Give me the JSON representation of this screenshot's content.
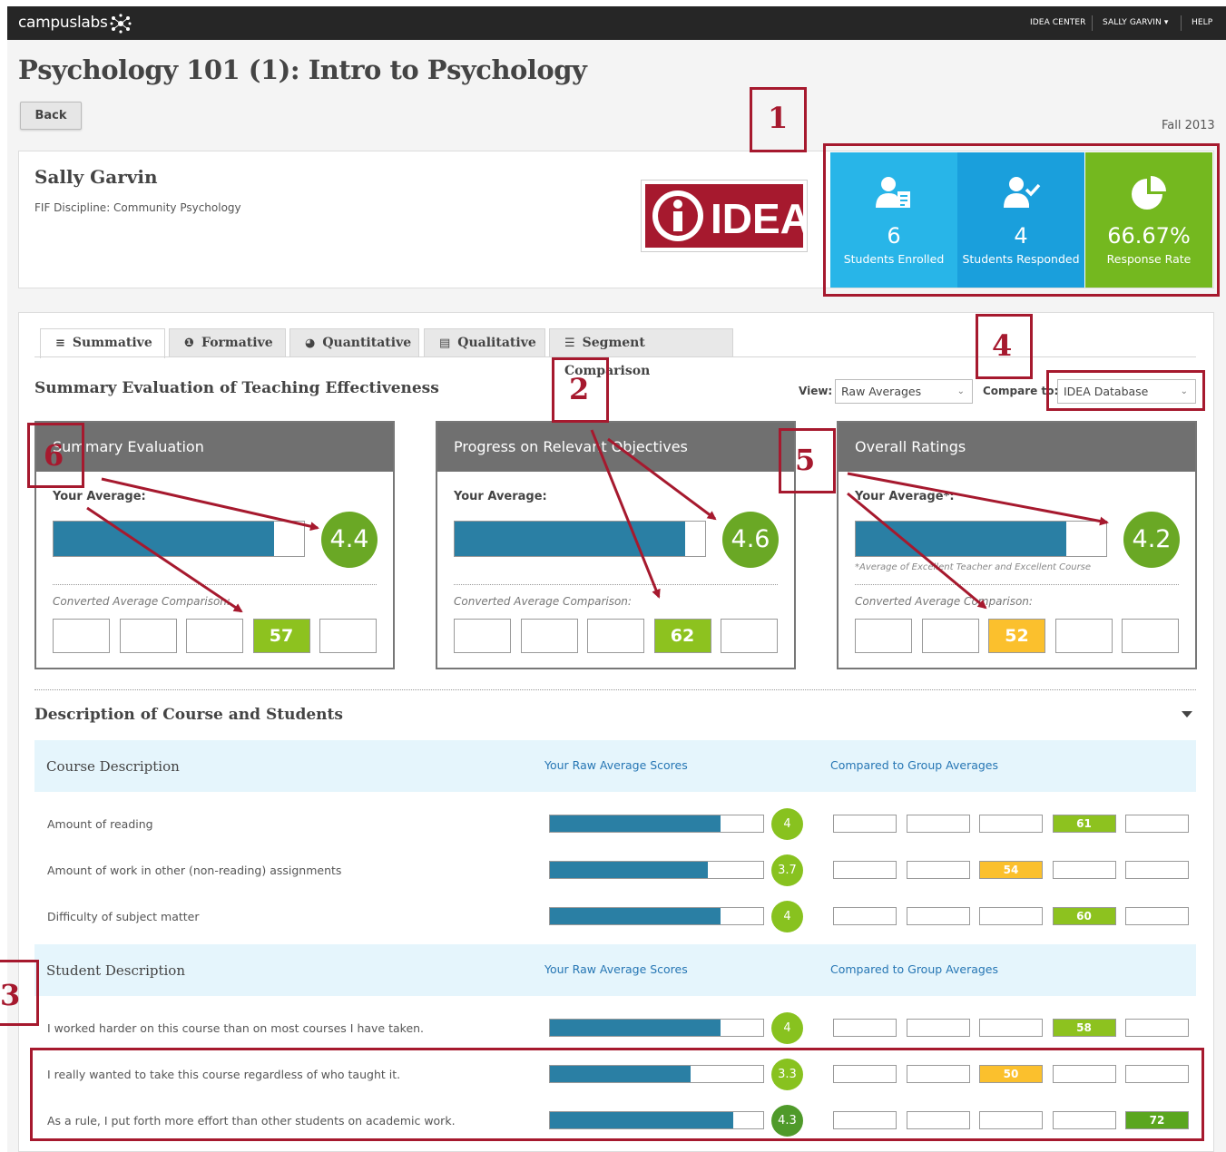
{
  "topbar": {
    "logo": "campuslabs",
    "links": [
      "IDEA CENTER",
      "SALLY GARVIN ▾",
      "HELP"
    ]
  },
  "page": {
    "title": "Psychology 101 (1): Intro to Psychology",
    "back_label": "Back",
    "term": "Fall 2013"
  },
  "instructor": {
    "name": "Sally Garvin",
    "discipline": "FIF Discipline: Community Psychology",
    "logo_text": "IDEA"
  },
  "stats": [
    {
      "icon": "student-clipboard-icon",
      "value": "6",
      "label": "Students Enrolled",
      "color": "#28b5e8"
    },
    {
      "icon": "student-check-icon",
      "value": "4",
      "label": "Students Responded",
      "color": "#1a9fdc"
    },
    {
      "icon": "pie-chart-icon",
      "value": "66.67%",
      "label": "Response Rate",
      "color": "#74b81f"
    }
  ],
  "tabs": [
    {
      "label": "Summative",
      "icon": "bar-chart-icon",
      "glyph": "≡"
    },
    {
      "label": "Formative",
      "icon": "info-icon",
      "glyph": "❶"
    },
    {
      "label": "Quantitative",
      "icon": "pie-icon",
      "glyph": "◕"
    },
    {
      "label": "Qualitative",
      "icon": "document-icon",
      "glyph": "▤"
    },
    {
      "label": "Segment Comparison",
      "icon": "sliders-icon",
      "glyph": "☰"
    }
  ],
  "summary": {
    "section_title": "Summary Evaluation of Teaching Effectiveness",
    "view_label": "View:",
    "view_value": "Raw Averages",
    "compare_label": "Compare to:",
    "compare_value": "IDEA Database"
  },
  "panels": [
    {
      "title": "Summary Evaluation",
      "your_avg": "Your Average:",
      "note": "",
      "value": "4.4",
      "fraction": 0.88,
      "conv_label": "Converted Average Comparison:",
      "conv_value": "57",
      "conv_index": 3,
      "conv_color": "#8dc21f"
    },
    {
      "title": "Progress on Relevant Objectives",
      "your_avg": "Your Average:",
      "note": "",
      "value": "4.6",
      "fraction": 0.92,
      "conv_label": "Converted Average Comparison:",
      "conv_value": "62",
      "conv_index": 3,
      "conv_color": "#8dc21f"
    },
    {
      "title": "Overall Ratings",
      "your_avg": "Your Average*:",
      "note": "*Average of Excellent Teacher and Excellent Course",
      "value": "4.2",
      "fraction": 0.84,
      "conv_label": "Converted Average Comparison:",
      "conv_value": "52",
      "conv_index": 2,
      "conv_color": "#fbc02d"
    }
  ],
  "description": {
    "title": "Description of Course and Students",
    "groups": [
      {
        "title": "Course Description",
        "col_raw": "Your Raw Average Scores",
        "col_compare": "Compared to Group Averages",
        "rows": [
          {
            "label": "Amount of reading",
            "value": "4",
            "fraction": 0.8,
            "cmp_value": "61",
            "cmp_index": 3,
            "cmp_color": "#8dc21f"
          },
          {
            "label": "Amount of work in other (non-reading) assignments",
            "value": "3.7",
            "fraction": 0.74,
            "cmp_value": "54",
            "cmp_index": 2,
            "cmp_color": "#fbc02d"
          },
          {
            "label": "Difficulty of subject matter",
            "value": "4",
            "fraction": 0.8,
            "cmp_value": "60",
            "cmp_index": 3,
            "cmp_color": "#8dc21f"
          }
        ]
      },
      {
        "title": "Student Description",
        "col_raw": "Your Raw Average Scores",
        "col_compare": "Compared to Group Averages",
        "rows": [
          {
            "label": "I worked harder on this course than on most courses I have taken.",
            "value": "4",
            "fraction": 0.8,
            "cmp_value": "58",
            "cmp_index": 3,
            "cmp_color": "#8dc21f"
          },
          {
            "label": "I really wanted to take this course regardless of who taught it.",
            "value": "3.3",
            "fraction": 0.66,
            "cmp_value": "50",
            "cmp_index": 2,
            "cmp_color": "#fbc02d"
          },
          {
            "label": "As a rule, I put forth more effort than other students on academic work.",
            "value": "4.3",
            "fraction": 0.86,
            "cmp_value": "72",
            "cmp_index": 4,
            "cmp_color": "#5aa61f"
          }
        ]
      }
    ]
  },
  "annotations": [
    "1",
    "2",
    "3",
    "4",
    "5",
    "6"
  ]
}
